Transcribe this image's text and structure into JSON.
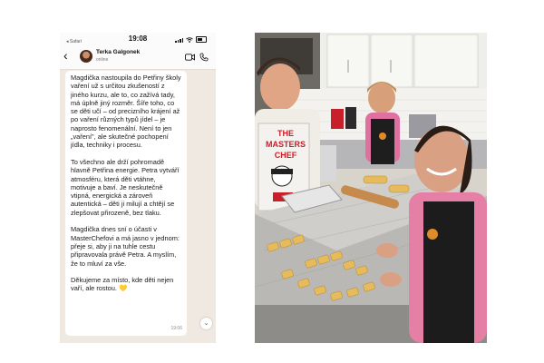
{
  "phone": {
    "status": {
      "back_label": "◂ Safari",
      "time": "19:08"
    },
    "header": {
      "contact_name": "Terka Galgonek",
      "contact_status": "online"
    },
    "message": {
      "paragraphs": [
        "Magdička nastoupila do Petřiny školy vaření už s určitou zkušeností z jiného kurzu, ale to, co zažívá tady, má úplně jiný rozměr. Šíře toho, co se děti učí – od precizního krájení až po vaření různých typů jídel – je naprosto fenomenální. Není to jen „vaření\", ale skutečné pochopení jídla, techniky i procesu.",
        "To všechno ale drží pohromadě hlavně Petřina energie. Petra vytváří atmosféru, která děti vtáhne, motivuje a baví. Je neskutečně vtipná, energická a zároveň autentická – děti ji milují a chtějí se zlepšovat přirozeně, bez tlaku.",
        "Magdička dnes sní o účasti v MasterChefovi a má jasno v jednom: přeje si, aby ji na tuhle cestu připravovala právě Petra. A myslím, že to mluví za vše.",
        "Děkujeme za místo, kde děti nejen vaří, ale rostou. 💛"
      ],
      "time": "19:06"
    },
    "scroll_down_glyph": "⌄"
  },
  "photo": {
    "apron_text": [
      "THE",
      "MASTERS",
      "CHEF"
    ]
  }
}
